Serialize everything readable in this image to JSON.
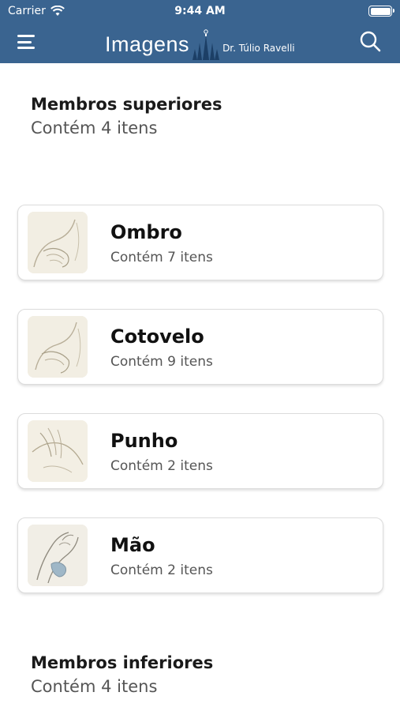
{
  "status_bar": {
    "carrier": "Carrier",
    "time": "9:44 AM"
  },
  "header": {
    "title": "Imagens",
    "subtitle": "Dr. Túlio Ravelli",
    "menu_icon": "hamburger-menu-icon",
    "search_icon": "search-icon",
    "color": "#3a6490"
  },
  "sections": [
    {
      "title": "Membros superiores",
      "subtitle": "Contém 4 itens"
    },
    {
      "title": "Membros inferiores",
      "subtitle": "Contém 4 itens"
    }
  ],
  "items": [
    {
      "title": "Ombro",
      "subtitle": "Contém 7 itens"
    },
    {
      "title": "Cotovelo",
      "subtitle": "Contém 9 itens"
    },
    {
      "title": "Punho",
      "subtitle": "Contém 2 itens"
    },
    {
      "title": "Mão",
      "subtitle": "Contém 2 itens"
    }
  ]
}
